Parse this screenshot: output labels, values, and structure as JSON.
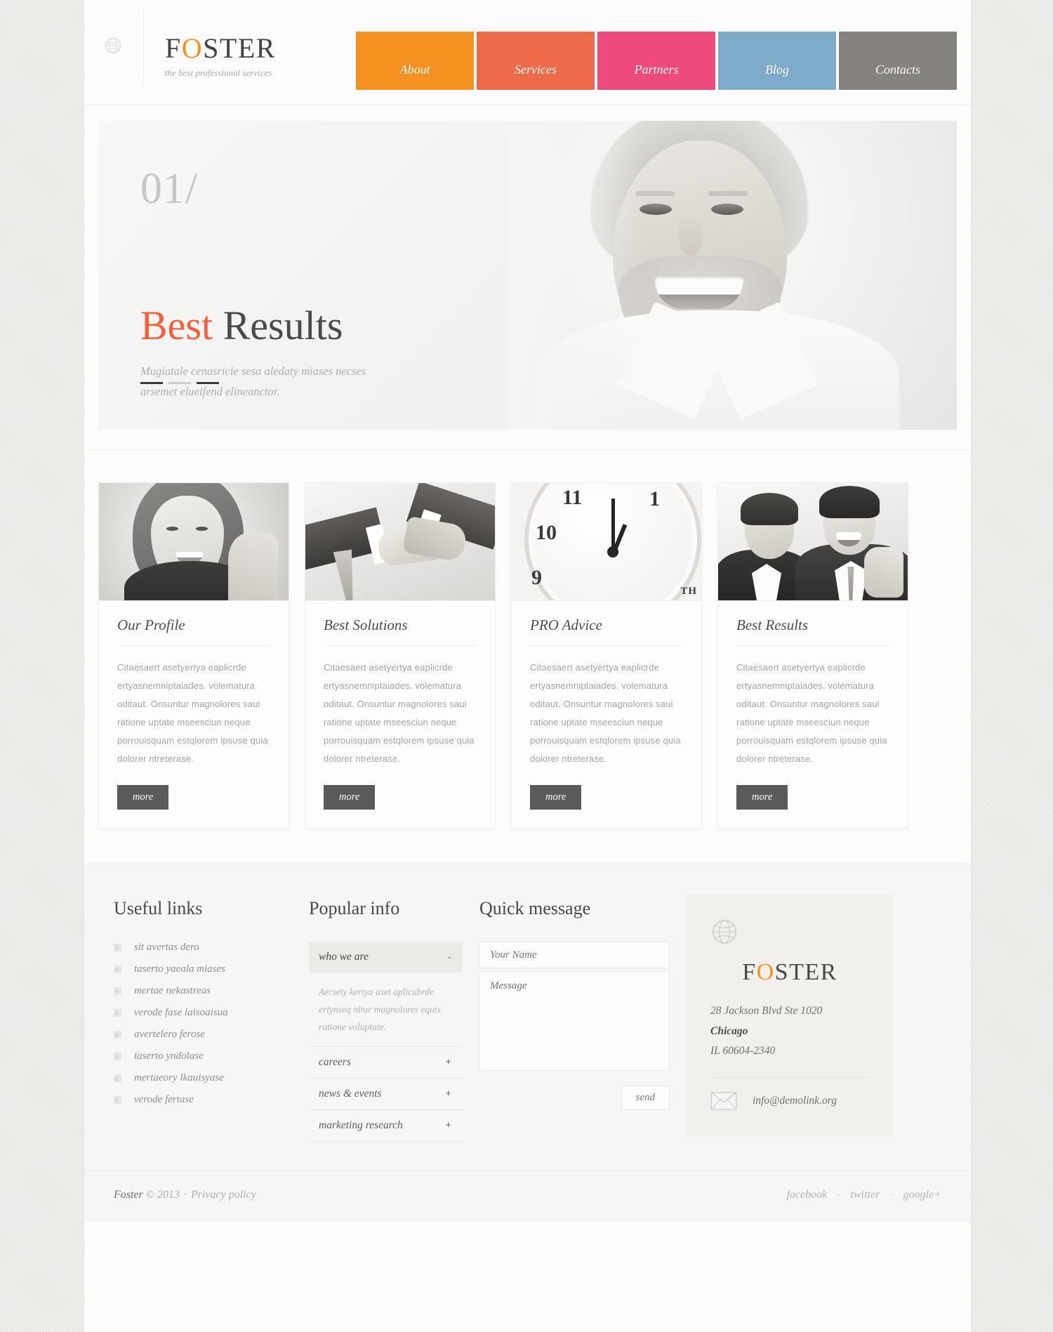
{
  "theme": {
    "page_bg": "#ebe9e6",
    "card_bg": "#fcfcfc",
    "accent_orange": "#f59120",
    "accent_red": "#f4603c",
    "text_dark": "#4a4846",
    "text_muted": "#a9a7a4"
  },
  "header": {
    "globe_icon": "globe-icon",
    "logo_part1": "F",
    "logo_accent": "O",
    "logo_part2": "STER",
    "logo_full": "FOSTER",
    "tagline": "the best professional services",
    "nav": [
      {
        "label": "About",
        "color": "#f59120"
      },
      {
        "label": "Services",
        "color": "#ed6b4a"
      },
      {
        "label": "Partners",
        "color": "#ee4a7b"
      },
      {
        "label": "Blog",
        "color": "#7fabcb"
      },
      {
        "label": "Contacts",
        "color": "#86837f"
      }
    ]
  },
  "slider": {
    "number": "01/",
    "title_highlight": "Best",
    "title_rest": "Results",
    "subtitle": "Mugiatale cenasricie sesa aledaty miases necses arsemet elueifend elineanctor.",
    "pagination": [
      {
        "active": true
      },
      {
        "active": false
      },
      {
        "active": true
      }
    ]
  },
  "cards": [
    {
      "thumb": "woman-portrait-photo",
      "title": "Our Profile",
      "text": "Citaesaert asetyertya eaplicrde ertyasnemniptaiades. volematura oditaut. Onsuntur magnolores saui ratione uptate mseesciun neque porrouisquam estqlorem ipsuse quia dolorer ntreterase.",
      "button": "more"
    },
    {
      "thumb": "handshake-photo",
      "title": "Best Solutions",
      "text": "Citaesaert asetyertya eaplicrde ertyasnemniptaiades. volematura oditaut. Onsuntur magnolores saui ratione uptate mseesciun neque porrouisquam estqlorem ipsuse quia dolorer ntreterase.",
      "button": "more"
    },
    {
      "thumb": "clock-photo",
      "title": "PRO Advice",
      "text": "Citaesaert asetyertya eaplicrde ertyasnemniptaiades. volematura oditaut. Onsuntur magnolores saui ratione uptate mseesciun neque porrouisquam estqlorem ipsuse quia dolorer ntreterase.",
      "button": "more",
      "thumb_badge": "TH"
    },
    {
      "thumb": "two-businessmen-photo",
      "title": "Best Results",
      "text": "Citaesaert asetyertya eaplicrde ertyasnemniptaiades. volematura oditaut. Onsuntur magnolores saui ratione uptate mseesciun neque porrouisquam estqlorem ipsuse quia dolorer ntreterase.",
      "button": "more"
    }
  ],
  "footer": {
    "useful_links": {
      "heading": "Useful links",
      "items": [
        "sit avertas dero",
        "taserto yaeala miases",
        "mertae nekastreas",
        "verode fase laisoaisua",
        "avertelero ferose",
        "taserto yndolase",
        "mertaeory lkauisyase",
        "verode fertase"
      ]
    },
    "popular_info": {
      "heading": "Popular info",
      "items": [
        {
          "label": "who we are",
          "open": true,
          "sign": "-",
          "body": "Aersety kertya aset aplicabrde ertynseq nitur magnolores equis ratione voluptate."
        },
        {
          "label": "careers",
          "open": false,
          "sign": "+",
          "body": ""
        },
        {
          "label": "news & events",
          "open": false,
          "sign": "+",
          "body": ""
        },
        {
          "label": "marketing research",
          "open": false,
          "sign": "+",
          "body": ""
        }
      ]
    },
    "quick_message": {
      "heading": "Quick message",
      "name_placeholder": "Your Name",
      "name_value": "",
      "message_placeholder": "Message",
      "message_value": "",
      "send_label": "send"
    },
    "contact_card": {
      "globe_icon": "globe-icon",
      "logo_part1": "F",
      "logo_accent": "O",
      "logo_part2": "STER",
      "address_line1": "28 Jackson Blvd Ste 1020",
      "address_city": "Chicago",
      "address_line3": "IL 60604-2340",
      "mail_icon": "envelope-icon",
      "email": "info@demolink.org"
    }
  },
  "bottom_bar": {
    "brand": "Foster",
    "copyright": "© 2013",
    "separator": "·",
    "privacy": "Privacy policy",
    "socials": [
      "facebook",
      "twitter",
      "google+"
    ]
  }
}
